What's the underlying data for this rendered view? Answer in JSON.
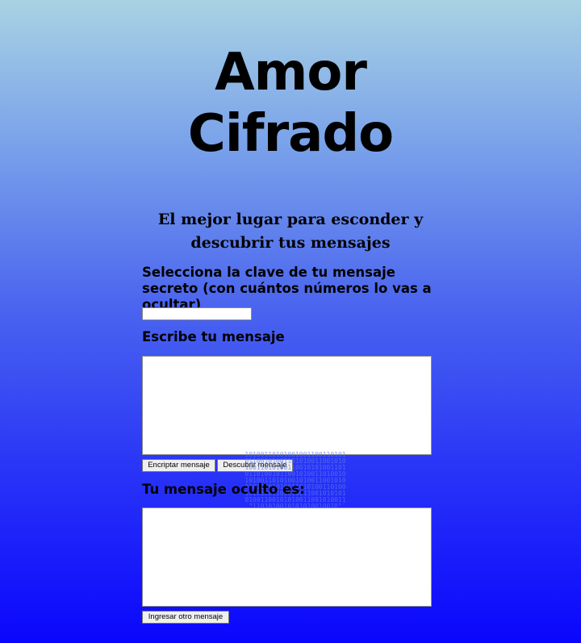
{
  "header": {
    "title_line1": "Amor",
    "title_line2": "Cifrado",
    "subtitle": "El mejor lugar para esconder y descubrir tus mensajes"
  },
  "form": {
    "key_label": "Selecciona la clave de tu mensaje secreto (con cuántos números lo vas a ocultar)",
    "key_value": "",
    "message_label": "Escribe tu mensaje",
    "message_value": "",
    "encrypt_button": "Encriptar mensaje",
    "decrypt_button": "Descubrir mensaje",
    "output_label": "Tu mensaje oculto es:",
    "output_value": "",
    "reset_button": "Ingresar otro mensaje"
  },
  "decoration": {
    "background_top_color": "#a9d2e3",
    "background_bottom_color": "#0a06fd",
    "binary_art_icon": "binary-heart-icon"
  }
}
